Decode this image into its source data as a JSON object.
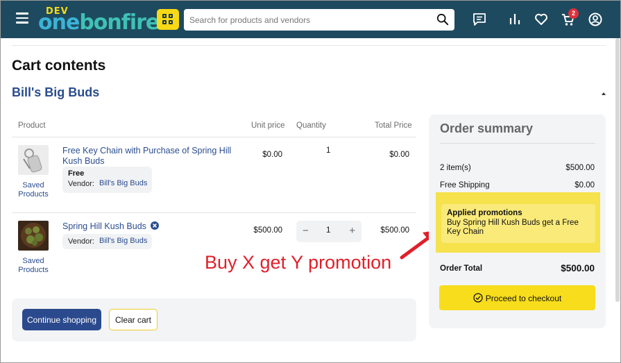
{
  "header": {
    "logo_dev": "DEV",
    "logo_one": "one",
    "logo_bonfire": "bonfire",
    "search_placeholder": "Search for products and vendors",
    "cart_count": "2",
    "icons": [
      "menu-icon",
      "apps-grid-icon",
      "search-icon",
      "chat-icon",
      "stats-icon",
      "heart-icon",
      "cart-icon",
      "account-icon"
    ]
  },
  "page": {
    "title": "Cart contents",
    "store_name": "Bill's Big Buds"
  },
  "table": {
    "columns": [
      "Product",
      "Unit price",
      "Quantity",
      "Total Price"
    ],
    "items": [
      {
        "name": "Free Key Chain with Purchase of Spring Hill Kush Buds",
        "free_label": "Free",
        "vendor_label": "Vendor:",
        "vendor": "Bill's Big Buds",
        "saved_label": "Saved Products",
        "unit_price": "$0.00",
        "quantity": "1",
        "total_price": "$0.00"
      },
      {
        "name": "Spring Hill Kush Buds",
        "vendor_label": "Vendor:",
        "vendor": "Bill's Big Buds",
        "saved_label": "Saved Products",
        "unit_price": "$500.00",
        "quantity": "1",
        "total_price": "$500.00"
      }
    ]
  },
  "annotation": "Buy X get Y promotion",
  "actions": {
    "continue_label": "Continue shopping",
    "clear_label": "Clear cart"
  },
  "summary": {
    "title": "Order summary",
    "items_label": "2 item(s)",
    "items_value": "$500.00",
    "shipping_label": "Free Shipping",
    "shipping_value": "$0.00",
    "promo_title": "Applied promotions",
    "promo_text": "Buy Spring Hill Kush Buds get a Free Key Chain",
    "total_label": "Order Total",
    "total_value": "$500.00",
    "checkout_label": "Proceed to checkout"
  },
  "colors": {
    "header_bg": "#1e4a5f",
    "accent_yellow": "#f7dd1c",
    "link_blue": "#2a4d8f",
    "annotation_red": "#e0202a"
  }
}
